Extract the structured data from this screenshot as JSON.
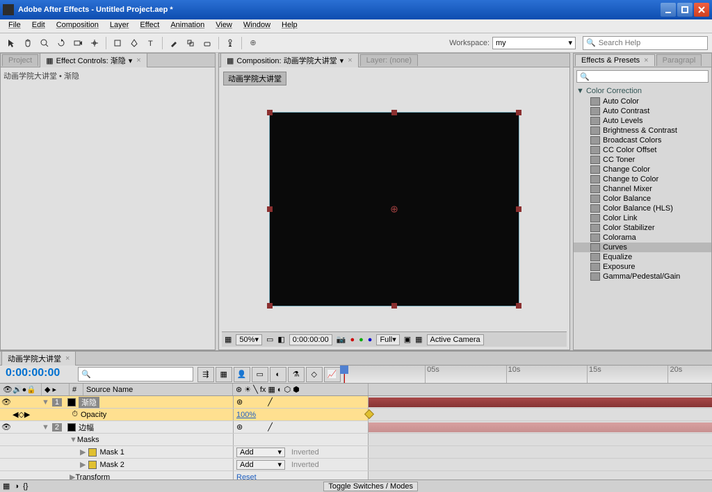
{
  "title": "Adobe After Effects - Untitled Project.aep *",
  "menu": [
    "File",
    "Edit",
    "Composition",
    "Layer",
    "Effect",
    "Animation",
    "View",
    "Window",
    "Help"
  ],
  "workspace": {
    "label": "Workspace:",
    "value": "my"
  },
  "search_help": {
    "placeholder": "Search Help"
  },
  "left_panel": {
    "tab_project": "Project",
    "tab_effect_controls": "Effect Controls: 渐隐",
    "header_text": "动画学院大讲堂 • 渐隐"
  },
  "center_panel": {
    "tab_composition": "Composition: 动画学院大讲堂",
    "tab_layer": "Layer: (none)",
    "comp_name": "动画学院大讲堂",
    "zoom": "50%",
    "timecode": "0:00:00:00",
    "res": "Full",
    "view": "Active Camera"
  },
  "right_panel": {
    "tab_presets": "Effects & Presets",
    "tab_paragraph": "Paragrapl",
    "category": "Color Correction",
    "items": [
      "Auto Color",
      "Auto Contrast",
      "Auto Levels",
      "Brightness & Contrast",
      "Broadcast Colors",
      "CC Color Offset",
      "CC Toner",
      "Change Color",
      "Change to Color",
      "Channel Mixer",
      "Color Balance",
      "Color Balance (HLS)",
      "Color Link",
      "Color Stabilizer",
      "Colorama",
      "Curves",
      "Equalize",
      "Exposure",
      "Gamma/Pedestal/Gain"
    ],
    "selected": "Curves"
  },
  "timeline": {
    "tab": "动画学院大讲堂",
    "timecode": "0:00:00:00",
    "cols": {
      "num": "#",
      "source": "Source Name"
    },
    "ruler": [
      "05s",
      "10s",
      "15s",
      "20s"
    ],
    "layers": [
      {
        "num": "1",
        "name": "渐隐",
        "color": "black",
        "selected": true
      },
      {
        "prop": "Opacity",
        "value": "100%"
      },
      {
        "num": "2",
        "name": "边幅",
        "color": "black"
      }
    ],
    "masks_label": "Masks",
    "mask1": "Mask 1",
    "mask2": "Mask 2",
    "mask_mode": "Add",
    "inverted": "Inverted",
    "transform": "Transform",
    "reset": "Reset",
    "toggle": "Toggle Switches / Modes"
  }
}
